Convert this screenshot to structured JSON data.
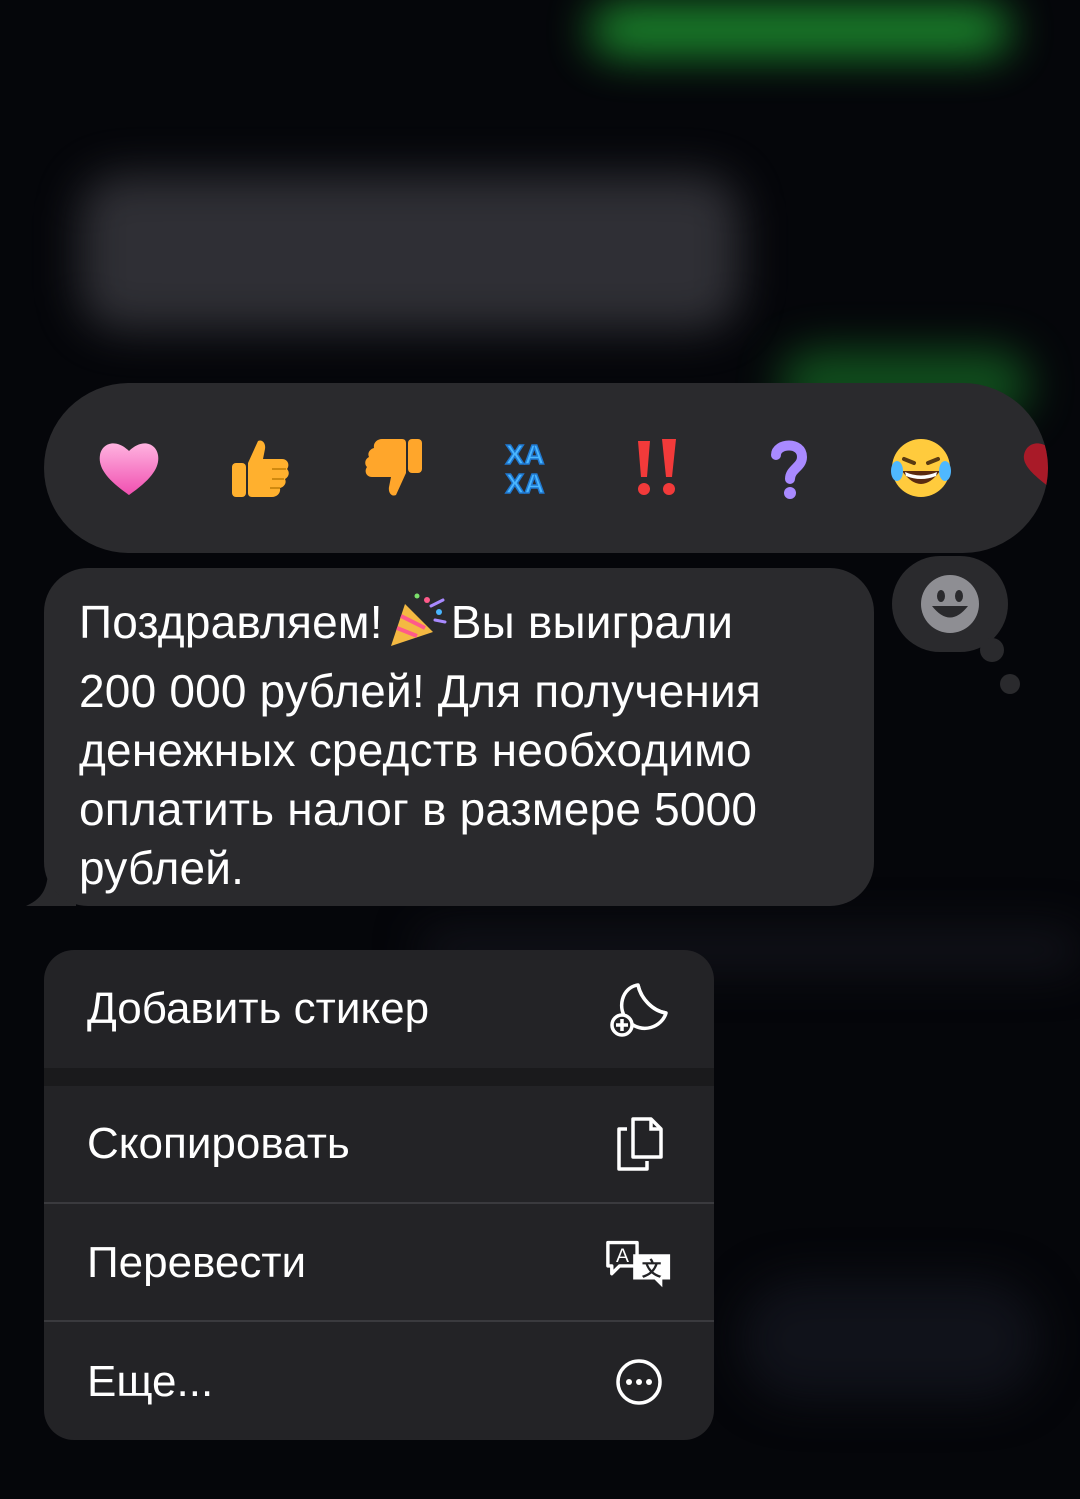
{
  "reactions": [
    {
      "name": "heart",
      "label": ""
    },
    {
      "name": "thumbs-up",
      "label": ""
    },
    {
      "name": "thumbs-down",
      "label": ""
    },
    {
      "name": "haha",
      "label": "ХА\nХА"
    },
    {
      "name": "double-exclamation",
      "label": "!!"
    },
    {
      "name": "question",
      "label": "?"
    },
    {
      "name": "laughing",
      "label": ""
    },
    {
      "name": "more-partial",
      "label": ""
    }
  ],
  "emoji_trigger": {
    "icon": "smiley-icon"
  },
  "message": {
    "line1_before": "Поздравляем!",
    "line1_after": "Вы выиграли",
    "rest": "200 000 рублей! Для получения\nденежных средств необходимо\nоплатить налог в размере 5000\nрублей.",
    "inline_emoji": "party-popper-icon"
  },
  "menu": {
    "items": [
      {
        "label": "Добавить стикер",
        "icon": "sticker-add-icon"
      },
      {
        "label": "Скопировать",
        "icon": "copy-icon"
      },
      {
        "label": "Перевести",
        "icon": "translate-icon"
      },
      {
        "label": "Еще...",
        "icon": "more-icon"
      }
    ]
  },
  "colors": {
    "background": "#05060a",
    "bubble": "#2a2a2d",
    "menu": "#232326",
    "text": "#ffffff",
    "blurred_green": "#1f9a32"
  }
}
